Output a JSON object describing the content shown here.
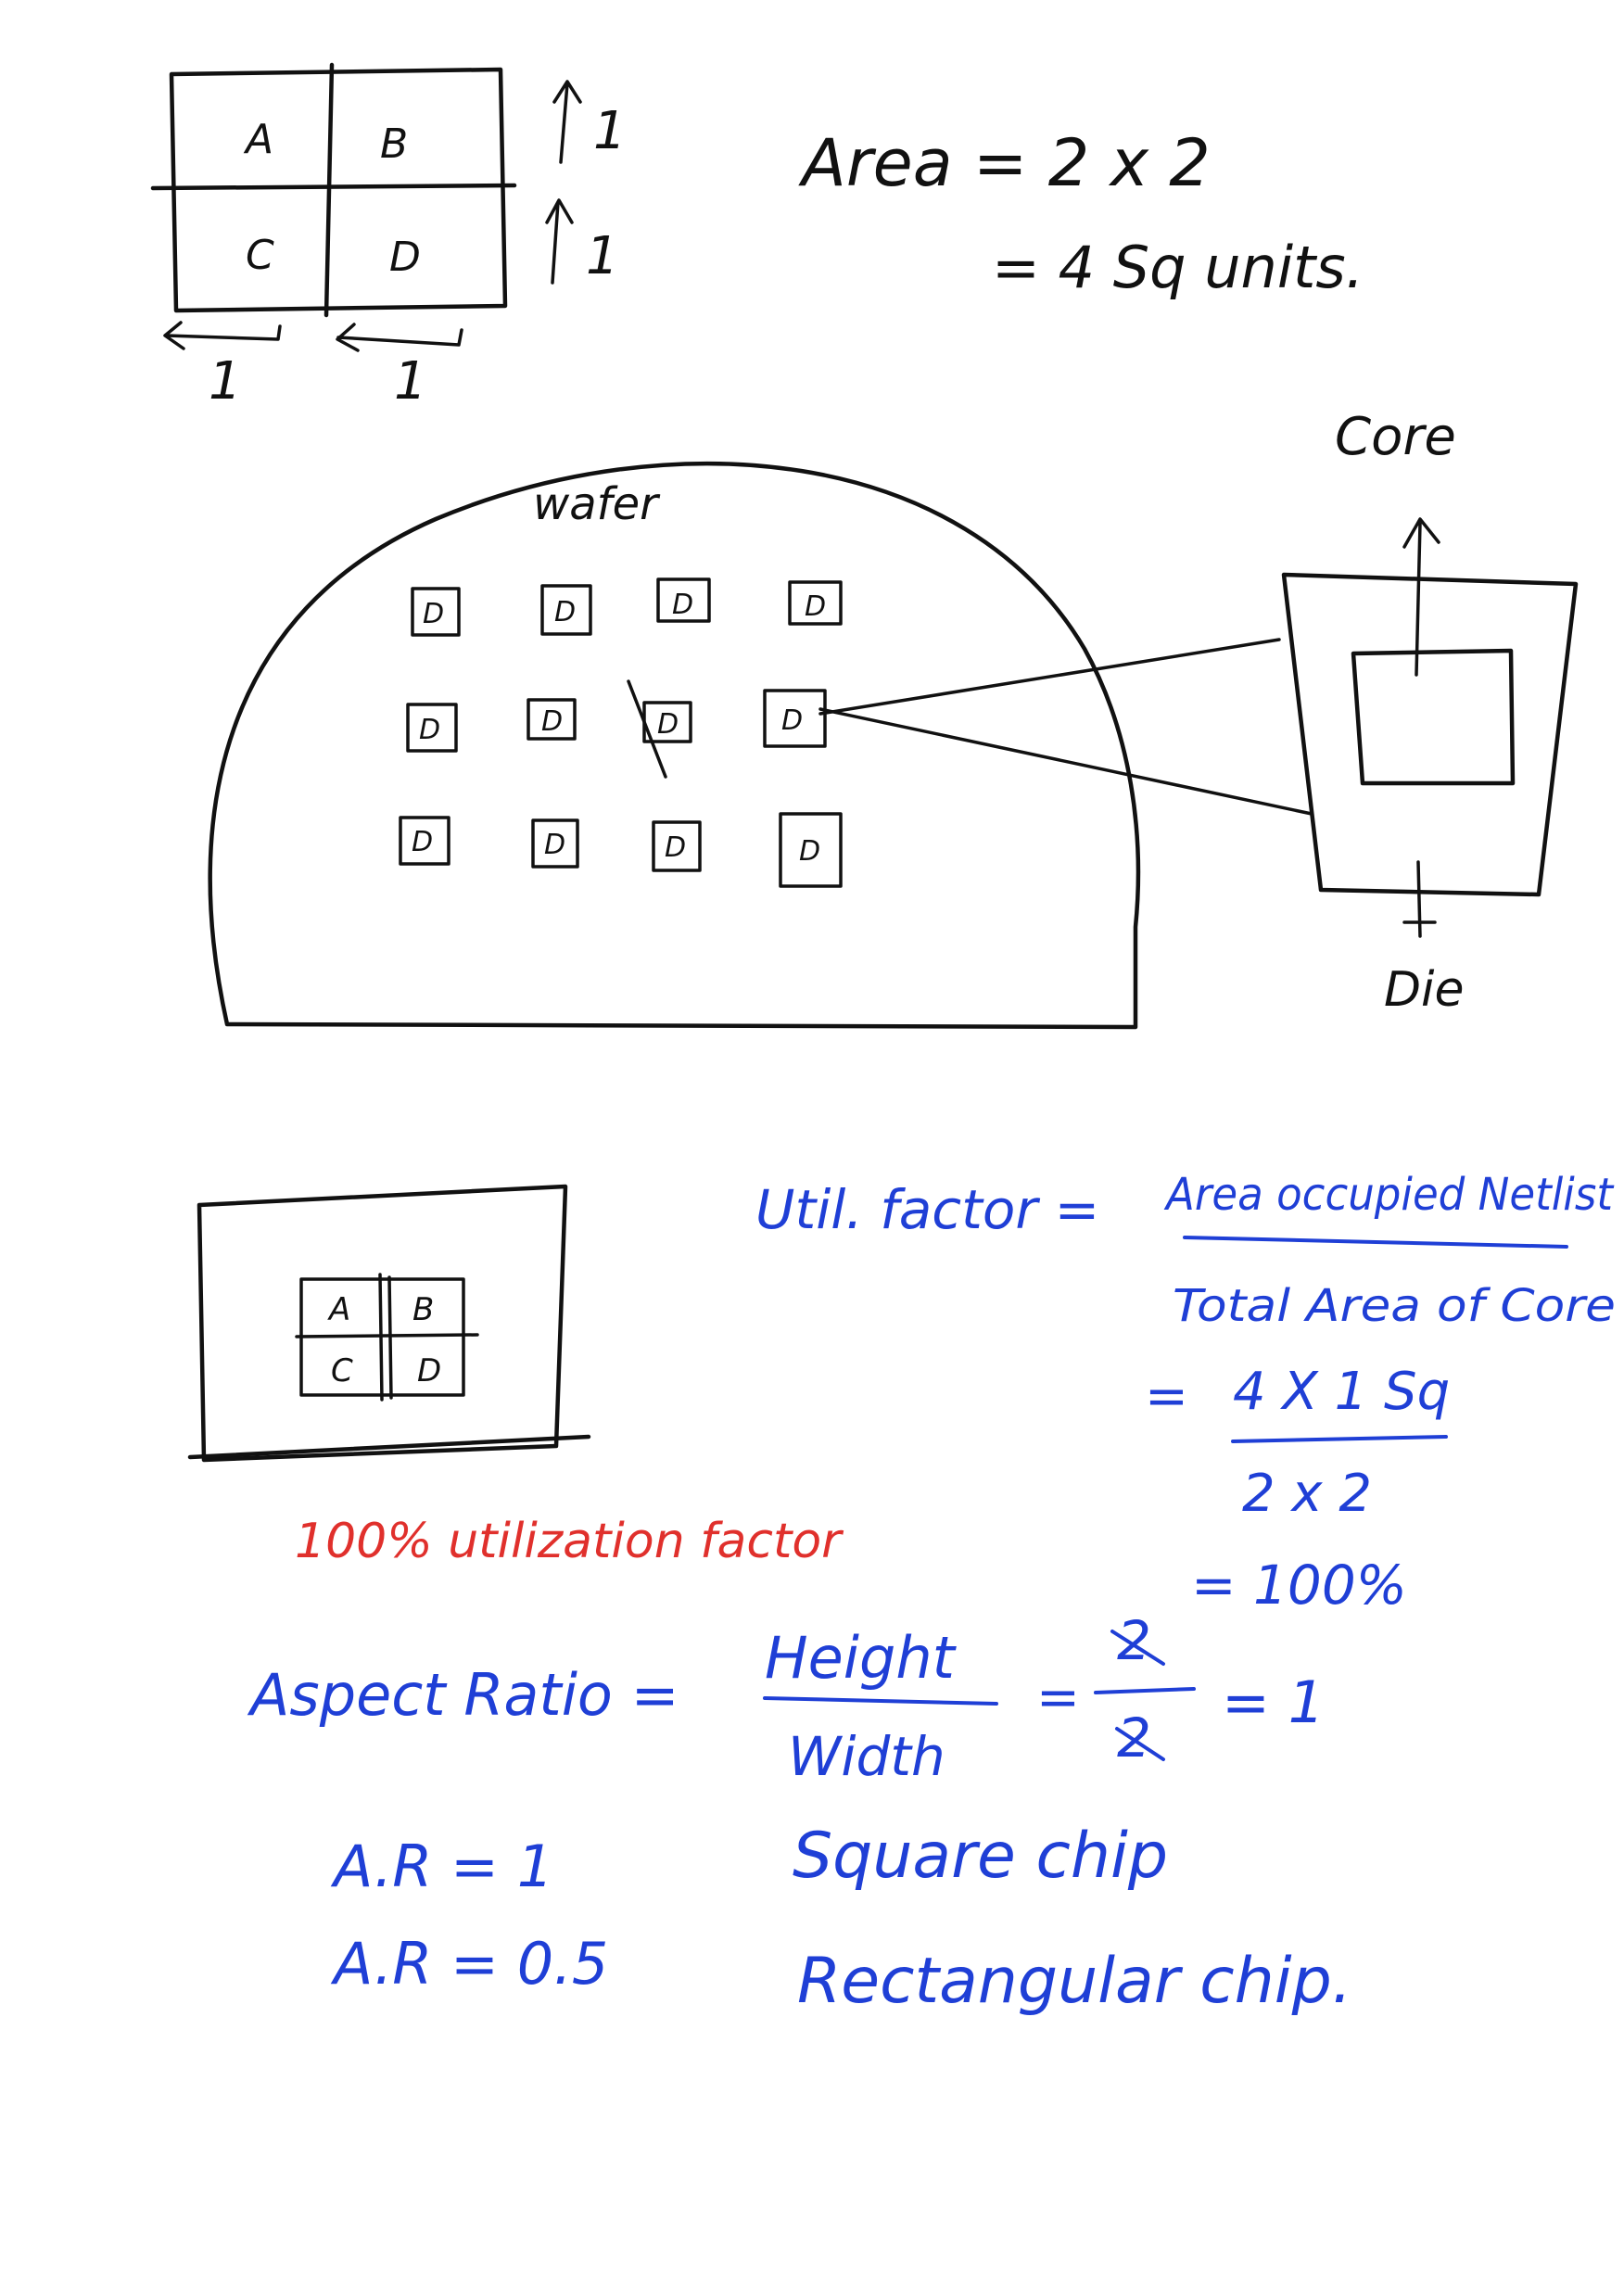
{
  "colors": {
    "black_ink": "#111111",
    "blue_ink": "#1f3fd6",
    "red_ink": "#e0302c",
    "paper": "#ffffff"
  },
  "grid": {
    "cells": [
      "A",
      "B",
      "C",
      "D"
    ],
    "side_labels": [
      "1",
      "1"
    ],
    "bottom_labels": [
      "1",
      "1"
    ]
  },
  "area_calc": {
    "line1": "Area = 2 x 2",
    "line2": "= 4 Sq units."
  },
  "wafer": {
    "label": "wafer",
    "die_marks": [
      "D",
      "D",
      "D",
      "D",
      "D",
      "D",
      "D",
      "D",
      "D",
      "D",
      "D",
      "D"
    ],
    "core_label": "Core",
    "die_label": "Die"
  },
  "floorplan": {
    "cells": [
      "A",
      "B",
      "C",
      "D"
    ],
    "caption": "100% utilization factor"
  },
  "util": {
    "lhs": "Util. factor =",
    "numerator": "Area occupied Netlist",
    "denominator": "Total Area of Core",
    "eq2_prefix": "=",
    "eq2_num": "4 X 1 Sq",
    "eq2_den": "2 x 2",
    "result": "= 100%"
  },
  "aspect": {
    "lhs": "Aspect Ratio =",
    "numerator": "Height",
    "denominator": "Width",
    "eq": "=",
    "frac_num": "2",
    "frac_den": "2",
    "result": "= 1"
  },
  "ratios": [
    {
      "lhs": "A.R = 1",
      "desc": "Square chip"
    },
    {
      "lhs": "A.R = 0.5",
      "desc": "Rectangular chip."
    }
  ]
}
